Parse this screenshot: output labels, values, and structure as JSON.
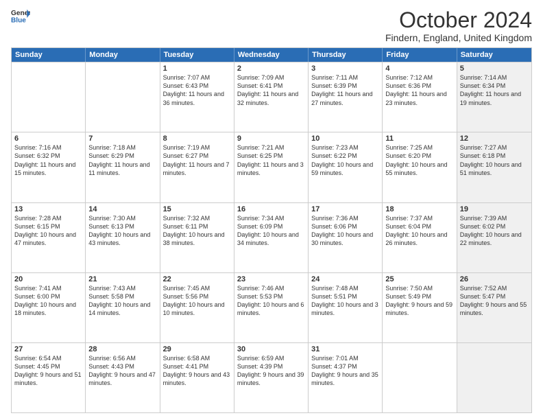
{
  "header": {
    "logo_general": "General",
    "logo_blue": "Blue",
    "month_title": "October 2024",
    "location": "Findern, England, United Kingdom"
  },
  "days_of_week": [
    "Sunday",
    "Monday",
    "Tuesday",
    "Wednesday",
    "Thursday",
    "Friday",
    "Saturday"
  ],
  "rows": [
    [
      {
        "day": "",
        "text": "",
        "shaded": false
      },
      {
        "day": "",
        "text": "",
        "shaded": false
      },
      {
        "day": "1",
        "text": "Sunrise: 7:07 AM\nSunset: 6:43 PM\nDaylight: 11 hours and 36 minutes.",
        "shaded": false
      },
      {
        "day": "2",
        "text": "Sunrise: 7:09 AM\nSunset: 6:41 PM\nDaylight: 11 hours and 32 minutes.",
        "shaded": false
      },
      {
        "day": "3",
        "text": "Sunrise: 7:11 AM\nSunset: 6:39 PM\nDaylight: 11 hours and 27 minutes.",
        "shaded": false
      },
      {
        "day": "4",
        "text": "Sunrise: 7:12 AM\nSunset: 6:36 PM\nDaylight: 11 hours and 23 minutes.",
        "shaded": false
      },
      {
        "day": "5",
        "text": "Sunrise: 7:14 AM\nSunset: 6:34 PM\nDaylight: 11 hours and 19 minutes.",
        "shaded": true
      }
    ],
    [
      {
        "day": "6",
        "text": "Sunrise: 7:16 AM\nSunset: 6:32 PM\nDaylight: 11 hours and 15 minutes.",
        "shaded": false
      },
      {
        "day": "7",
        "text": "Sunrise: 7:18 AM\nSunset: 6:29 PM\nDaylight: 11 hours and 11 minutes.",
        "shaded": false
      },
      {
        "day": "8",
        "text": "Sunrise: 7:19 AM\nSunset: 6:27 PM\nDaylight: 11 hours and 7 minutes.",
        "shaded": false
      },
      {
        "day": "9",
        "text": "Sunrise: 7:21 AM\nSunset: 6:25 PM\nDaylight: 11 hours and 3 minutes.",
        "shaded": false
      },
      {
        "day": "10",
        "text": "Sunrise: 7:23 AM\nSunset: 6:22 PM\nDaylight: 10 hours and 59 minutes.",
        "shaded": false
      },
      {
        "day": "11",
        "text": "Sunrise: 7:25 AM\nSunset: 6:20 PM\nDaylight: 10 hours and 55 minutes.",
        "shaded": false
      },
      {
        "day": "12",
        "text": "Sunrise: 7:27 AM\nSunset: 6:18 PM\nDaylight: 10 hours and 51 minutes.",
        "shaded": true
      }
    ],
    [
      {
        "day": "13",
        "text": "Sunrise: 7:28 AM\nSunset: 6:15 PM\nDaylight: 10 hours and 47 minutes.",
        "shaded": false
      },
      {
        "day": "14",
        "text": "Sunrise: 7:30 AM\nSunset: 6:13 PM\nDaylight: 10 hours and 43 minutes.",
        "shaded": false
      },
      {
        "day": "15",
        "text": "Sunrise: 7:32 AM\nSunset: 6:11 PM\nDaylight: 10 hours and 38 minutes.",
        "shaded": false
      },
      {
        "day": "16",
        "text": "Sunrise: 7:34 AM\nSunset: 6:09 PM\nDaylight: 10 hours and 34 minutes.",
        "shaded": false
      },
      {
        "day": "17",
        "text": "Sunrise: 7:36 AM\nSunset: 6:06 PM\nDaylight: 10 hours and 30 minutes.",
        "shaded": false
      },
      {
        "day": "18",
        "text": "Sunrise: 7:37 AM\nSunset: 6:04 PM\nDaylight: 10 hours and 26 minutes.",
        "shaded": false
      },
      {
        "day": "19",
        "text": "Sunrise: 7:39 AM\nSunset: 6:02 PM\nDaylight: 10 hours and 22 minutes.",
        "shaded": true
      }
    ],
    [
      {
        "day": "20",
        "text": "Sunrise: 7:41 AM\nSunset: 6:00 PM\nDaylight: 10 hours and 18 minutes.",
        "shaded": false
      },
      {
        "day": "21",
        "text": "Sunrise: 7:43 AM\nSunset: 5:58 PM\nDaylight: 10 hours and 14 minutes.",
        "shaded": false
      },
      {
        "day": "22",
        "text": "Sunrise: 7:45 AM\nSunset: 5:56 PM\nDaylight: 10 hours and 10 minutes.",
        "shaded": false
      },
      {
        "day": "23",
        "text": "Sunrise: 7:46 AM\nSunset: 5:53 PM\nDaylight: 10 hours and 6 minutes.",
        "shaded": false
      },
      {
        "day": "24",
        "text": "Sunrise: 7:48 AM\nSunset: 5:51 PM\nDaylight: 10 hours and 3 minutes.",
        "shaded": false
      },
      {
        "day": "25",
        "text": "Sunrise: 7:50 AM\nSunset: 5:49 PM\nDaylight: 9 hours and 59 minutes.",
        "shaded": false
      },
      {
        "day": "26",
        "text": "Sunrise: 7:52 AM\nSunset: 5:47 PM\nDaylight: 9 hours and 55 minutes.",
        "shaded": true
      }
    ],
    [
      {
        "day": "27",
        "text": "Sunrise: 6:54 AM\nSunset: 4:45 PM\nDaylight: 9 hours and 51 minutes.",
        "shaded": false
      },
      {
        "day": "28",
        "text": "Sunrise: 6:56 AM\nSunset: 4:43 PM\nDaylight: 9 hours and 47 minutes.",
        "shaded": false
      },
      {
        "day": "29",
        "text": "Sunrise: 6:58 AM\nSunset: 4:41 PM\nDaylight: 9 hours and 43 minutes.",
        "shaded": false
      },
      {
        "day": "30",
        "text": "Sunrise: 6:59 AM\nSunset: 4:39 PM\nDaylight: 9 hours and 39 minutes.",
        "shaded": false
      },
      {
        "day": "31",
        "text": "Sunrise: 7:01 AM\nSunset: 4:37 PM\nDaylight: 9 hours and 35 minutes.",
        "shaded": false
      },
      {
        "day": "",
        "text": "",
        "shaded": false
      },
      {
        "day": "",
        "text": "",
        "shaded": true
      }
    ]
  ]
}
